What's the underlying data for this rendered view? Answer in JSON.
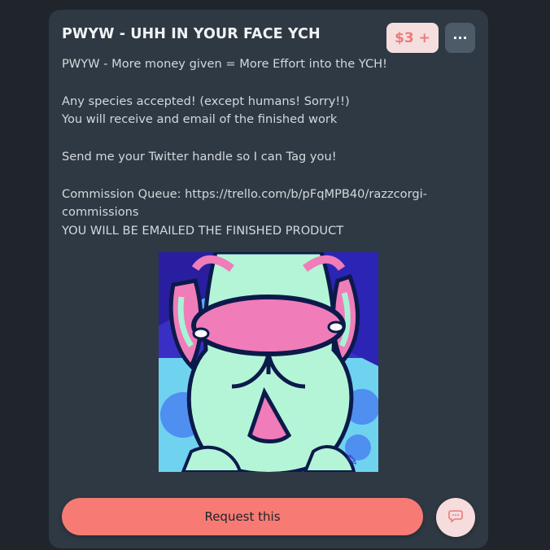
{
  "listing": {
    "title": "PWYW - UHH IN YOUR FACE YCH",
    "price": "$3 +",
    "more_label": "···",
    "description": [
      "PWYW - More money given = More Effort into the YCH!",
      "",
      "Any species accepted! (except humans! Sorry!!)",
      "You will receive and email of the finished work",
      "",
      "Send me your Twitter handle so I can Tag you!",
      "",
      "Commission Queue: https://trello.com/b/pFqMPB40/razzcorgi-",
      "commissions",
      "YOU WILL BE EMAILED THE FINISHED PRODUCT"
    ],
    "request_label": "Request this"
  },
  "colors": {
    "background": "#20252b",
    "card": "#2f3943",
    "accent": "#f77b74",
    "price_bg": "#f4dede",
    "price_text": "#ec7a7a"
  },
  "icons": {
    "more": "ellipsis-icon",
    "chat": "chat-bubble-icon"
  }
}
